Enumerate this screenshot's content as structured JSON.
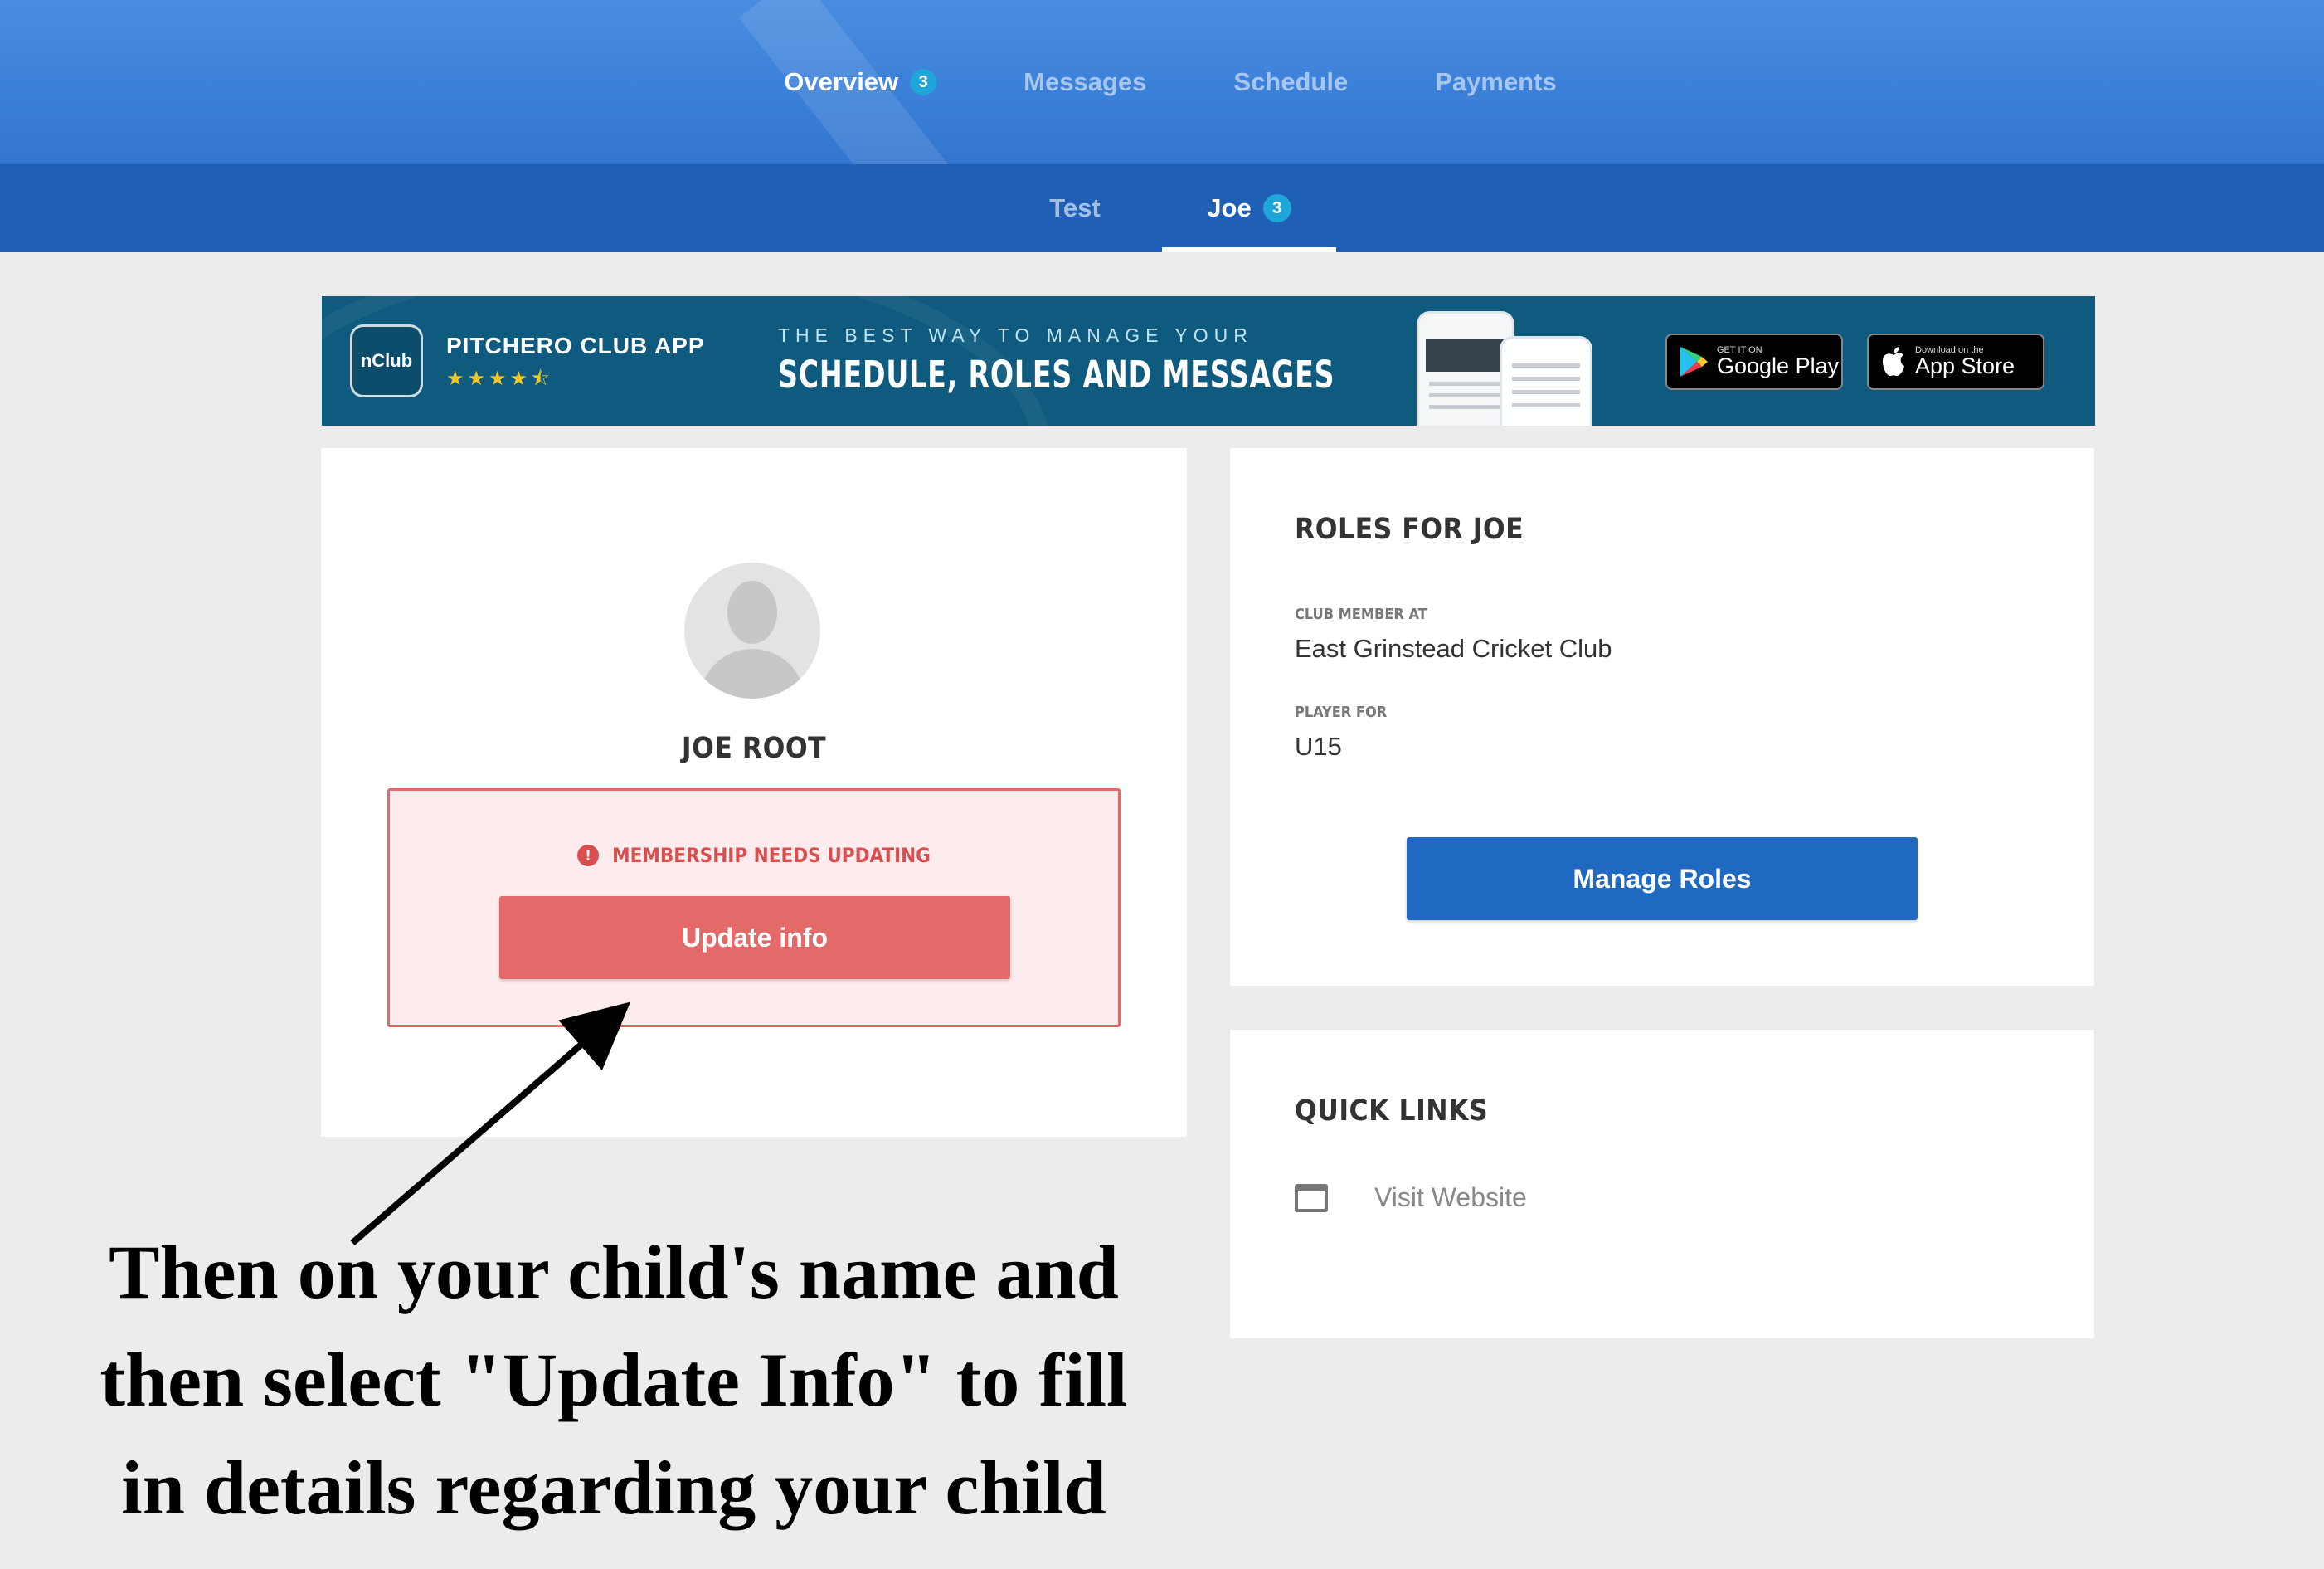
{
  "nav": {
    "tabs": [
      {
        "label": "Overview",
        "badge": "3"
      },
      {
        "label": "Messages"
      },
      {
        "label": "Schedule"
      },
      {
        "label": "Payments"
      }
    ],
    "active_tab": "Overview"
  },
  "subnav": {
    "tabs": [
      {
        "label": "Test"
      },
      {
        "label": "Joe",
        "badge": "3"
      }
    ],
    "active_tab": "Joe"
  },
  "banner": {
    "logo_text": "nClub",
    "app_name": "PITCHERO CLUB APP",
    "rating_stars": "★★★★⯪",
    "tagline_small": "THE BEST WAY TO MANAGE YOUR",
    "tagline_big": "SCHEDULE, ROLES AND MESSAGES",
    "google_play": {
      "small": "GET IT ON",
      "big": "Google Play"
    },
    "app_store": {
      "small": "Download on the",
      "big": "App Store"
    }
  },
  "profile": {
    "name": "JOE ROOT",
    "alert_text": "MEMBERSHIP NEEDS UPDATING",
    "update_button": "Update info"
  },
  "roles": {
    "title": "ROLES FOR JOE",
    "club_label": "CLUB MEMBER AT",
    "club_value": "East Grinstead Cricket Club",
    "player_label": "PLAYER FOR",
    "player_value": "U15",
    "manage_button": "Manage Roles"
  },
  "quick_links": {
    "title": "QUICK LINKS",
    "items": [
      {
        "label": "Visit Website",
        "icon": "window-icon"
      }
    ]
  },
  "instruction": {
    "line1": "Then on your child's name and",
    "line2": "then select \"Update Info\" to fill",
    "line3": "in details regarding your child"
  },
  "colors": {
    "nav_blue": "#3a7fd8",
    "subnav_blue": "#1f5fb5",
    "badge": "#1fa6d8",
    "banner": "#0f5b7f",
    "alert_red": "#e36a69",
    "primary_button": "#1f6ac0"
  }
}
